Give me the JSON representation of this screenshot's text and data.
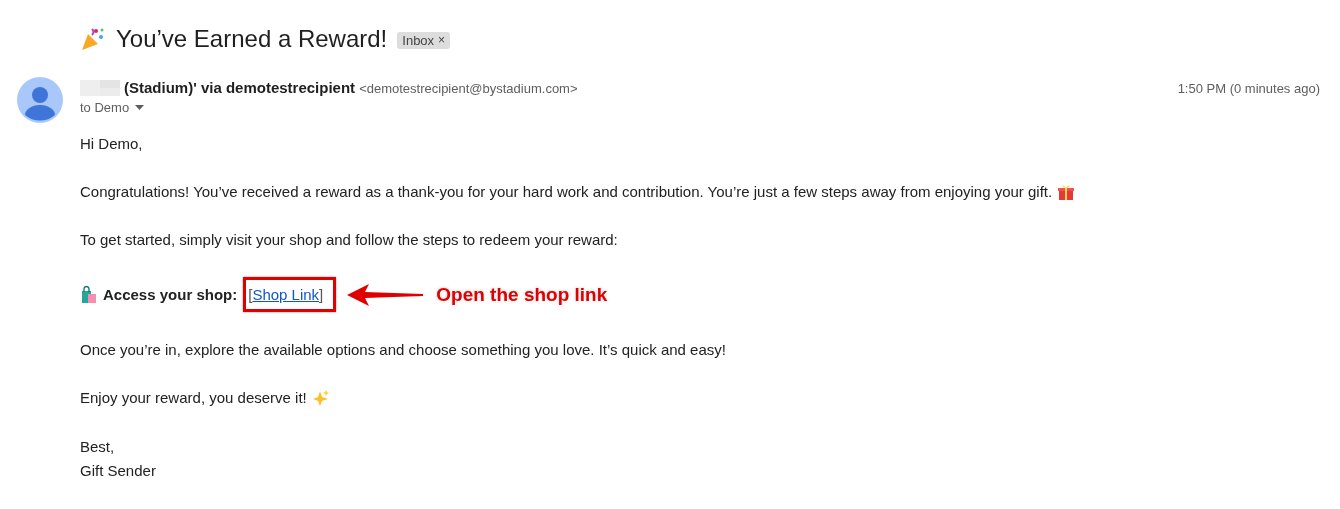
{
  "subject": {
    "title": "You’ve Earned a Reward!",
    "label": {
      "text": "Inbox",
      "remove": "×"
    }
  },
  "sender": {
    "name": "(Stadium)' via demotestrecipient",
    "email": "<demotestrecipient@bystadium.com>",
    "recipient": "to Demo",
    "time": "1:50 PM (0 minutes ago)"
  },
  "body": [
    {
      "kind": "text",
      "text": "Hi Demo,"
    },
    {
      "kind": "gift_text",
      "text": "Congratulations! You’ve received a reward as a thank-you for your hard work and contribution. You’re just a few steps away from enjoying your gift."
    },
    {
      "kind": "text",
      "text": "To get started, simply visit your shop and follow the steps to redeem your reward:"
    },
    {
      "kind": "link",
      "label": "Access your shop:",
      "open": "[",
      "link": "Shop Link",
      "close": "]",
      "annotation": "Open the shop link"
    },
    {
      "kind": "text",
      "text": "Once you’re in, explore the available options and choose something you love. It’s quick and easy!"
    },
    {
      "kind": "sparkle_text",
      "text": "Enjoy your reward, you deserve it!"
    },
    {
      "kind": "lines",
      "lines": [
        "Best,",
        "Gift Sender"
      ]
    }
  ]
}
